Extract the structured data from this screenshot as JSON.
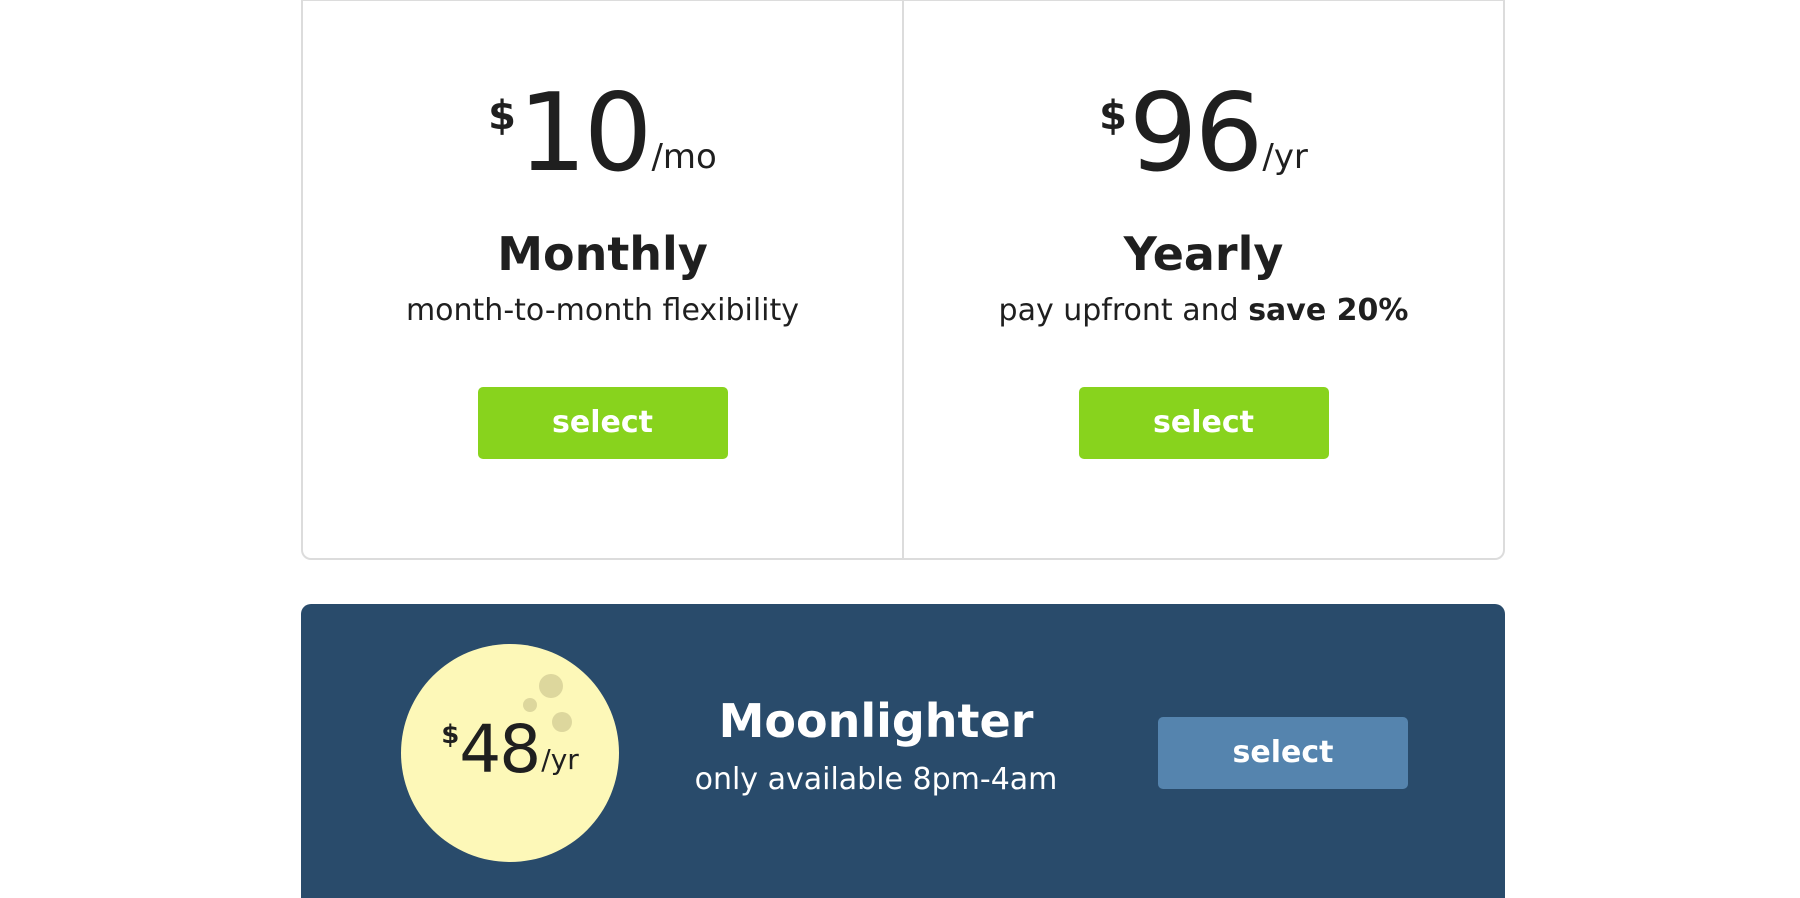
{
  "plans": [
    {
      "currency": "$",
      "amount": "10",
      "period": "/mo",
      "name": "Monthly",
      "description": "month-to-month flexibility",
      "button_label": "select"
    },
    {
      "currency": "$",
      "amount": "96",
      "period": "/yr",
      "name": "Yearly",
      "description_prefix": "pay upfront and ",
      "description_bold": "save 20%",
      "button_label": "select"
    }
  ],
  "moonlighter": {
    "currency": "$",
    "amount": "48",
    "period": "/yr",
    "name": "Moonlighter",
    "description": "only available 8pm-4am",
    "button_label": "select"
  },
  "colors": {
    "select_button": "#88d31d",
    "banner_background": "#294b6b",
    "banner_button": "#5584ae",
    "moon": "#fdf8b8"
  }
}
